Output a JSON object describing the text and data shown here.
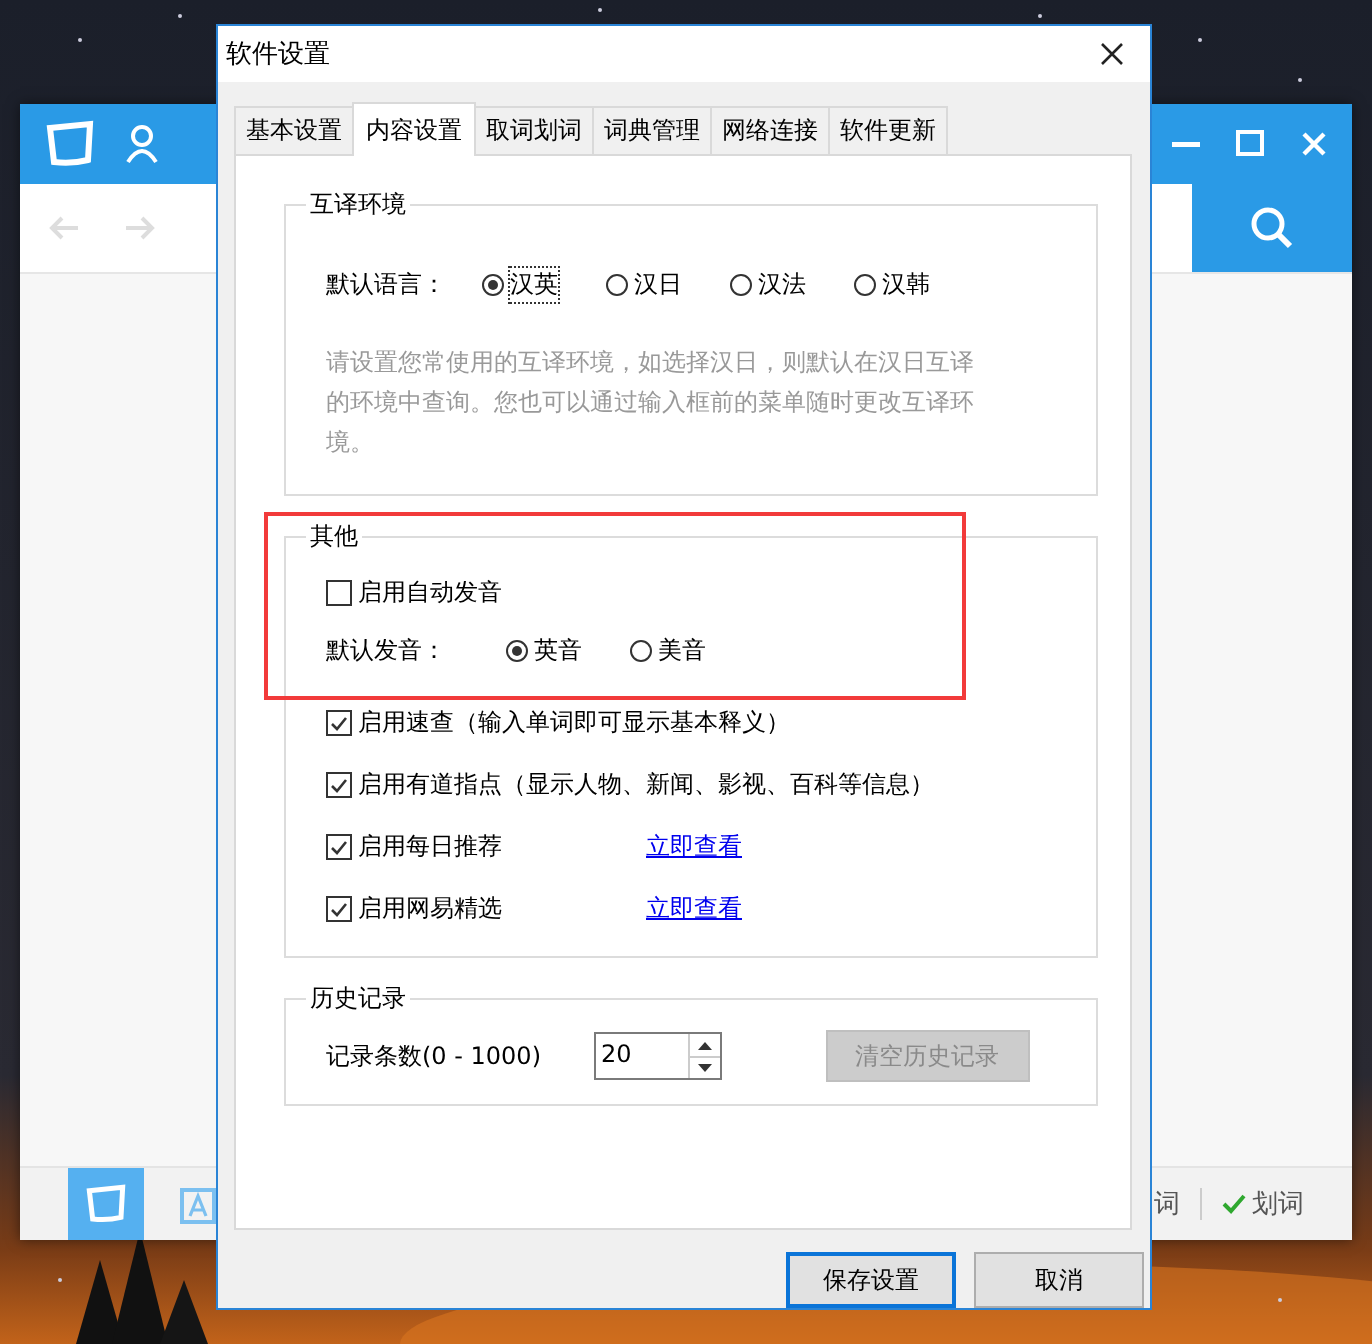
{
  "background_app": {
    "status_items": [
      {
        "label": "词",
        "checked": false
      },
      {
        "label": "划词",
        "checked": true
      }
    ]
  },
  "dialog": {
    "title": "软件设置",
    "tabs": [
      {
        "label": "基本设置",
        "selected": false
      },
      {
        "label": "内容设置",
        "selected": true
      },
      {
        "label": "取词划词",
        "selected": false
      },
      {
        "label": "词典管理",
        "selected": false
      },
      {
        "label": "网络连接",
        "selected": false
      },
      {
        "label": "软件更新",
        "selected": false
      }
    ],
    "translation_group": {
      "title": "互译环境",
      "label": "默认语言：",
      "options": [
        {
          "label": "汉英",
          "selected": true
        },
        {
          "label": "汉日",
          "selected": false
        },
        {
          "label": "汉法",
          "selected": false
        },
        {
          "label": "汉韩",
          "selected": false
        }
      ],
      "description": "请设置您常使用的互译环境，如选择汉日，则默认在汉日互译的环境中查询。您也可以通过输入框前的菜单随时更改互译环境。"
    },
    "other_group": {
      "title": "其他",
      "auto_pronounce": {
        "label": "启用自动发音",
        "checked": false
      },
      "pronunciation_label": "默认发音：",
      "pronunciation_options": [
        {
          "label": "英音",
          "selected": true
        },
        {
          "label": "美音",
          "selected": false
        }
      ],
      "checkboxes": [
        {
          "label": "启用速查（输入单词即可显示基本释义）",
          "checked": true
        },
        {
          "label": "启用有道指点（显示人物、新闻、影视、百科等信息）",
          "checked": true
        },
        {
          "label": "启用每日推荐",
          "checked": true,
          "link": "立即查看"
        },
        {
          "label": "启用网易精选",
          "checked": true,
          "link": "立即查看"
        }
      ]
    },
    "history_group": {
      "title": "历史记录",
      "label": "记录条数(0 - 1000)",
      "value": "20",
      "clear_button": {
        "label": "清空历史记录",
        "disabled": true
      }
    },
    "buttons": [
      {
        "label": "保存设置",
        "default": true
      },
      {
        "label": "取消",
        "default": false
      }
    ]
  }
}
